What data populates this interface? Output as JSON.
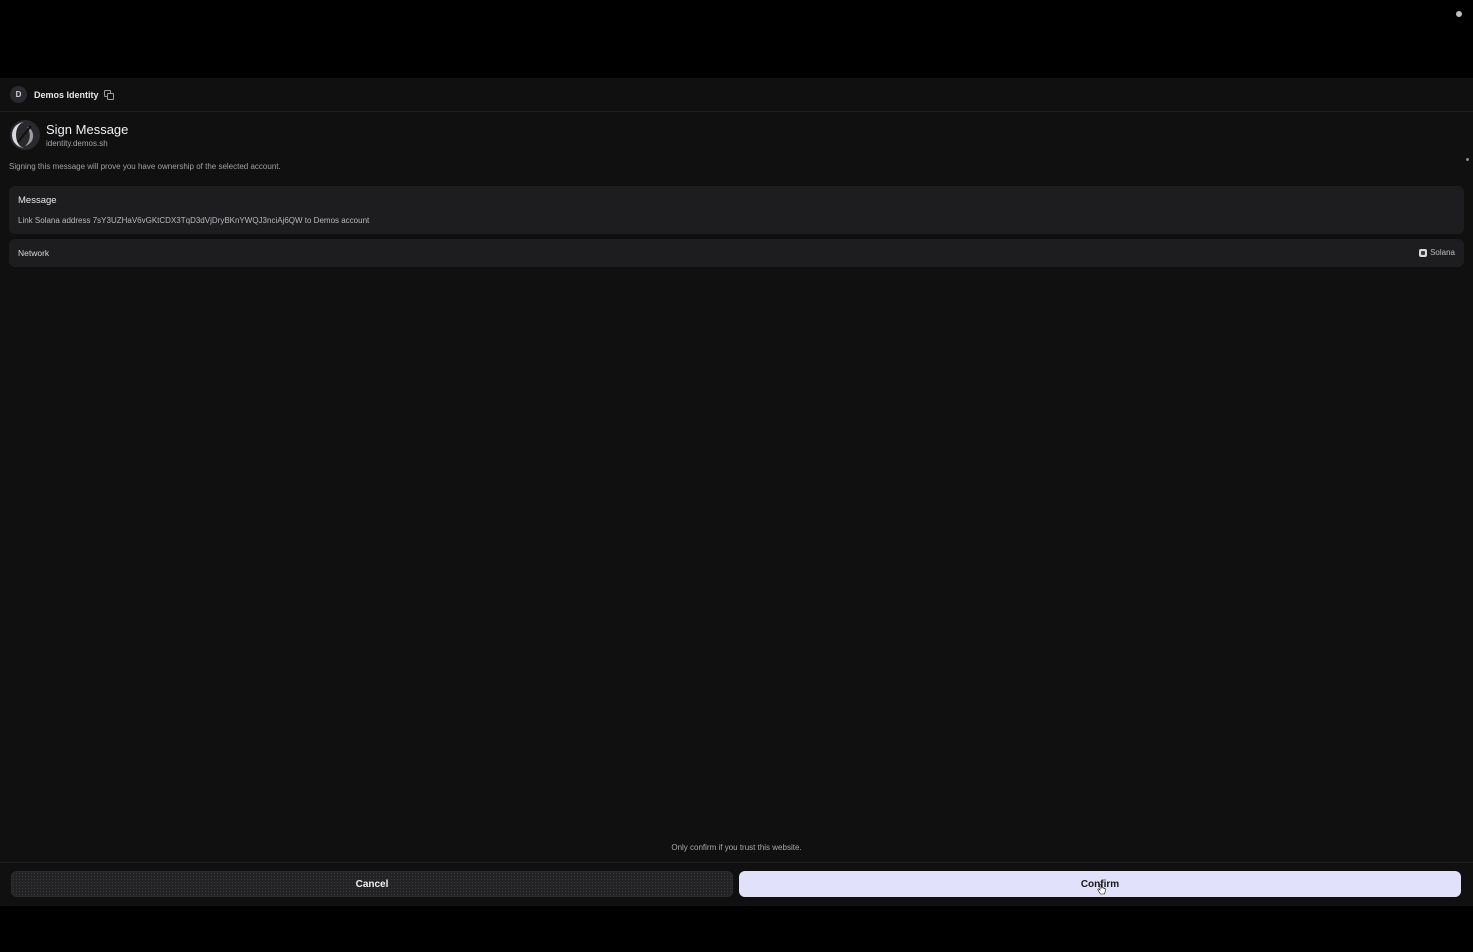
{
  "header": {
    "avatar_letter": "D",
    "identity_name": "Demos Identity"
  },
  "request": {
    "title": "Sign Message",
    "origin": "identity.demos.sh",
    "description": "Signing this message will prove you have ownership of the selected account."
  },
  "message_card": {
    "label": "Message",
    "value": "Link Solana address 7sY3UZHaV6vGKtCDX3TqD3dVjDryBKnYWQJ3nciAj6QW to Demos account"
  },
  "network_card": {
    "label": "Network",
    "value": "Solana",
    "icon": "solana-icon"
  },
  "footer": {
    "warning": "Only confirm if you trust this website.",
    "cancel_label": "Cancel",
    "confirm_label": "Confirm"
  },
  "colors": {
    "panel_bg": "#101011",
    "card_bg": "#1d1d20",
    "confirm_bg": "#e2e1fc"
  }
}
